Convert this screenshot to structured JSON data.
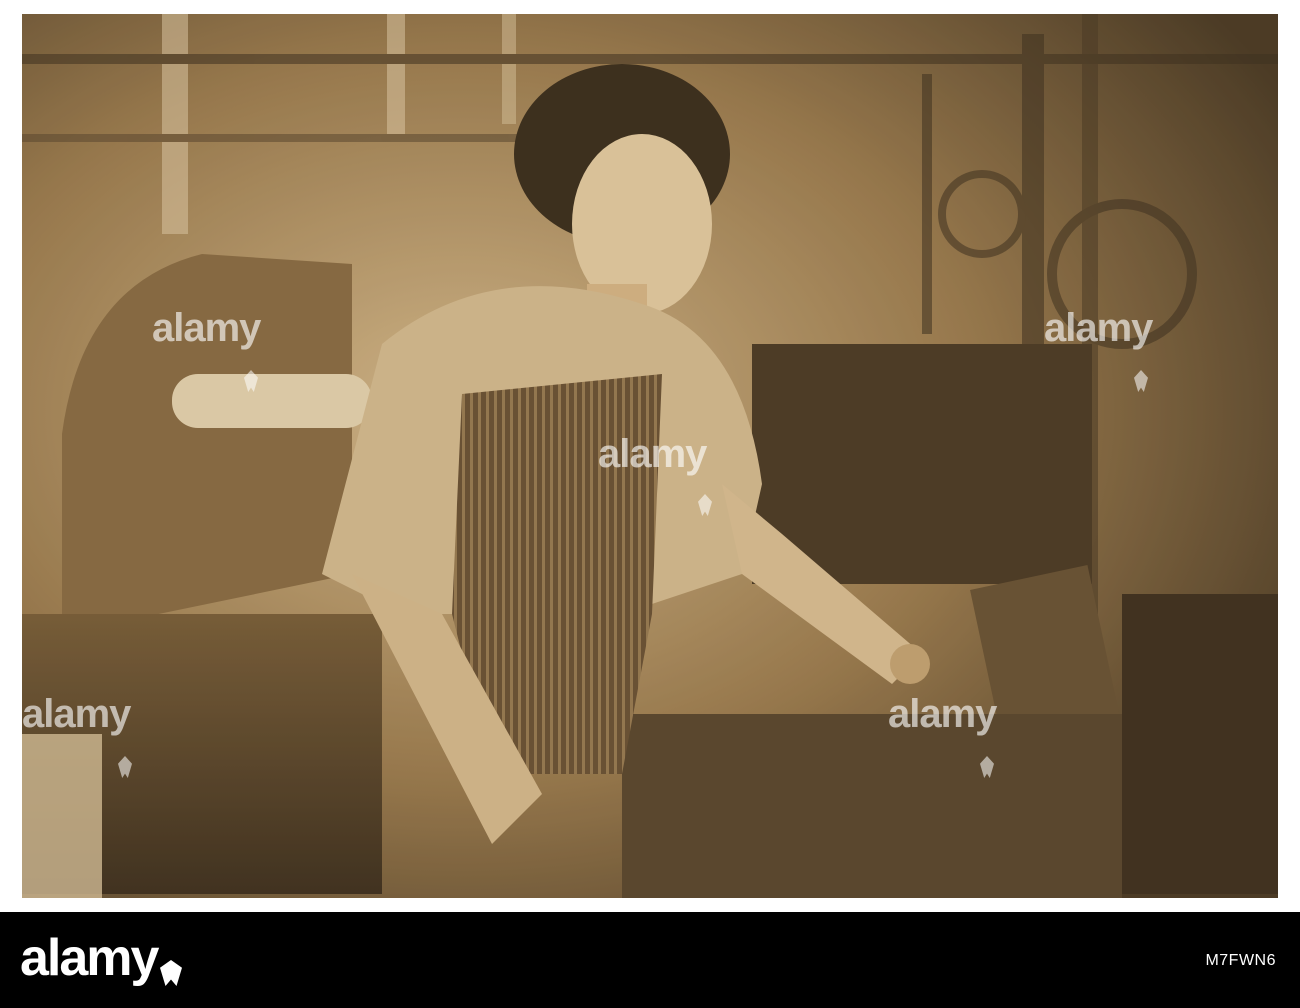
{
  "photo": {
    "subject-icons": [
      "woman-weaver-icon",
      "loom-icon",
      "mill-machinery-icon"
    ],
    "colors": {
      "sepia-light": "#e7dbc5",
      "sepia-mid": "#a98a5b",
      "sepia-dark": "#3a2a16"
    }
  },
  "watermark": {
    "text": "alamy"
  },
  "footer": {
    "brand": "alamy",
    "image_id": "M7FWN6"
  }
}
